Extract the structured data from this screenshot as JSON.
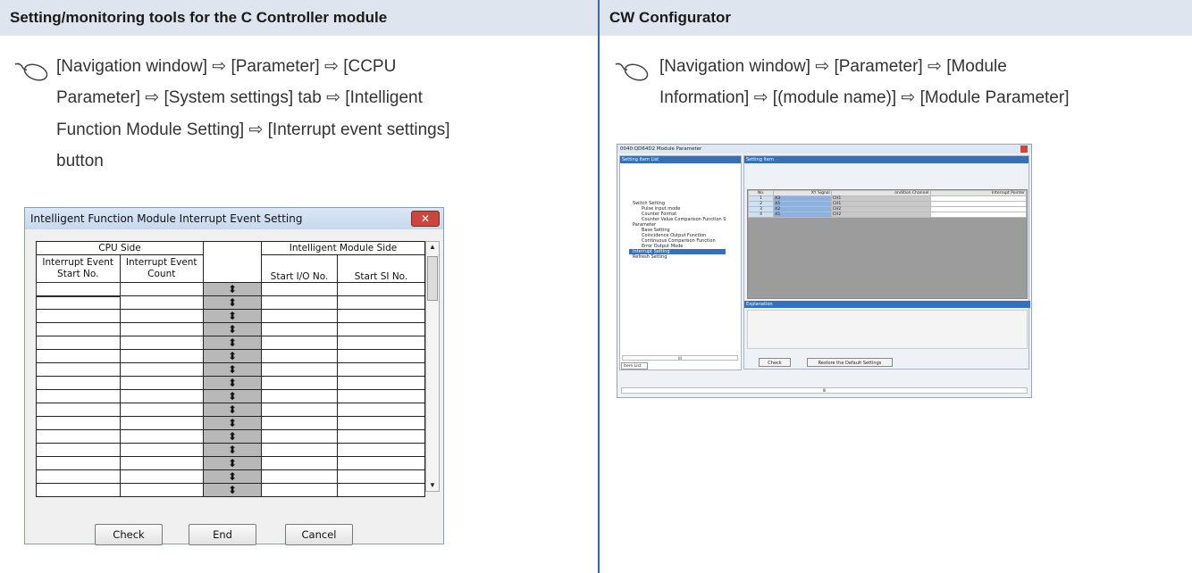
{
  "headers": {
    "left": "Setting/monitoring tools for the C Controller module",
    "right": "CW Configurator"
  },
  "left_path": {
    "line1": "[Navigation window] ⇨ [Parameter] ⇨ [CCPU",
    "line2": "Parameter] ⇨ [System settings] tab ⇨ [Intelligent",
    "line3": "Function Module Setting] ⇨ [Interrupt event settings]",
    "line4": "button"
  },
  "right_path": {
    "line1": "[Navigation window] ⇨ [Parameter] ⇨ [Module",
    "line2": "Information] ⇨ [(module name)] ⇨ [Module Parameter]"
  },
  "left_dialog": {
    "title": "Intelligent Function Module Interrupt Event Setting",
    "close": "✕",
    "group_cpu": "CPU Side",
    "group_intel": "Intelligent Module Side",
    "col1": "Interrupt Event Start No.",
    "col2": "Interrupt Event Count",
    "col3": "Start I/O No.",
    "col4": "Start SI No.",
    "arrow": "⬍",
    "rows": 16,
    "buttons": {
      "check": "Check",
      "end": "End",
      "cancel": "Cancel"
    }
  },
  "cw_dialog": {
    "title": "0040:QD64D2 Module Parameter",
    "setting_item_list": "Setting Item List",
    "setting_item": "Setting Item",
    "tree": [
      "Switch Setting",
      "Pulse input mode",
      "Counter Format",
      "Counter Value Comparison Function S",
      "Parameter",
      "Base Setting",
      "Coincidence Output Function",
      "Continuous Comparison Function",
      "Error Output Mode",
      "Interrupt Setting",
      "Refresh Setting"
    ],
    "table_headers": [
      "No.",
      "XY Signal",
      "ondition Channel",
      "Interrupt Pointer"
    ],
    "table_rows": [
      [
        "1",
        "X3",
        "CH1",
        ""
      ],
      [
        "2",
        "X5",
        "CH1",
        ""
      ],
      [
        "3",
        "X2",
        "CH2",
        ""
      ],
      [
        "4",
        "X5",
        "CH2",
        ""
      ]
    ],
    "explanation": "Explanation",
    "item_list_tab": "Item List",
    "btn_check": "Check",
    "btn_restore": "Restore the Default Settings",
    "scroll_mark": "III"
  }
}
